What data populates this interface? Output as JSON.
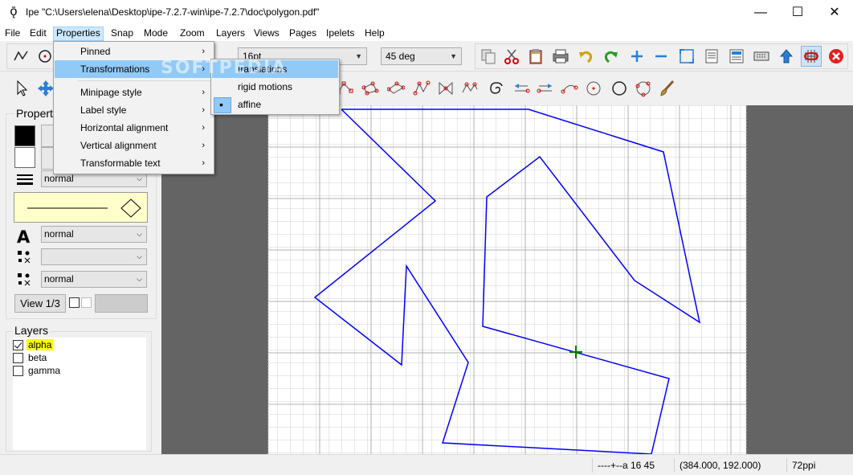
{
  "window": {
    "app_icon": "ipe-icon",
    "title": "Ipe \"C:\\Users\\elena\\Desktop\\ipe-7.2.7-win\\ipe-7.2.7\\doc\\polygon.pdf\"",
    "minimize": "—",
    "maximize": "☐",
    "close": "✕"
  },
  "menubar": {
    "items": [
      "File",
      "Edit",
      "Properties",
      "Snap",
      "Mode",
      "Zoom",
      "Layers",
      "Views",
      "Pages",
      "Ipelets",
      "Help"
    ],
    "active": "Properties"
  },
  "toolbar": {
    "font_size": "16pt",
    "angle": "45 deg"
  },
  "properties_panel": {
    "title": "Properties",
    "pen_width": "normal",
    "text_size": "normal",
    "symbol_size_1": "",
    "symbol_size_2": "normal",
    "view_button": "View 1/3",
    "stroke_color": "#000000",
    "fill_color": "#ffffff"
  },
  "layers_panel": {
    "title": "Layers",
    "layers": [
      {
        "name": "alpha",
        "checked": true,
        "active": true
      },
      {
        "name": "beta",
        "checked": false,
        "active": false
      },
      {
        "name": "gamma",
        "checked": false,
        "active": false
      }
    ]
  },
  "properties_menu": {
    "items": [
      {
        "label": "Pinned",
        "submenu": true
      },
      {
        "label": "Transformations",
        "submenu": true,
        "highlighted": true
      },
      {
        "label": "Minipage style",
        "submenu": true
      },
      {
        "label": "Label style",
        "submenu": true
      },
      {
        "label": "Horizontal alignment",
        "submenu": true
      },
      {
        "label": "Vertical alignment",
        "submenu": true
      },
      {
        "label": "Transformable text",
        "submenu": true
      }
    ]
  },
  "transformations_submenu": {
    "items": [
      {
        "label": "translations",
        "highlighted": true,
        "selected": false
      },
      {
        "label": "rigid motions",
        "highlighted": false,
        "selected": false
      },
      {
        "label": "affine",
        "highlighted": false,
        "selected": true
      }
    ]
  },
  "statusbar": {
    "snap_info": "----+--a 16 45",
    "coordinates": "(384.000, 192.000)",
    "resolution": "72ppi"
  },
  "watermark": "SOFTPEDIA",
  "colors": {
    "polygon_stroke": "#0000ff",
    "cursor_cross": "#008000",
    "canvas_bg": "#646464",
    "grid": "#d0d0d0"
  }
}
